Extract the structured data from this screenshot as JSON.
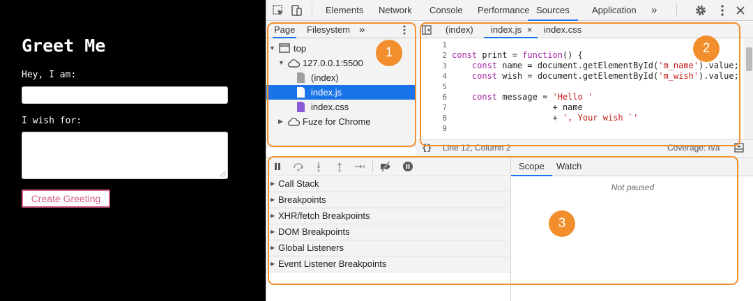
{
  "page": {
    "title": "Greet Me",
    "name_label": "Hey, I am:",
    "wish_label": "I wish for:",
    "button_label": "Create Greeting"
  },
  "devtools": {
    "tabs": [
      "Elements",
      "Network",
      "Console",
      "Performance",
      "Sources",
      "Application"
    ],
    "active_tab": "Sources",
    "more": "»",
    "navigator": {
      "tabs": [
        "Page",
        "Filesystem"
      ],
      "more": "»",
      "tree": [
        {
          "label": "top"
        },
        {
          "label": "127.0.0.1:5500"
        },
        {
          "label": "(index)"
        },
        {
          "label": "index.js",
          "selected": true
        },
        {
          "label": "index.css"
        },
        {
          "label": "Fuze for Chrome"
        }
      ]
    },
    "editor": {
      "tabs": [
        "(index)",
        "index.js",
        "index.css"
      ],
      "active_tab": "index.js",
      "close": "×",
      "lines": [
        {
          "n": "1",
          "code": ""
        },
        {
          "n": "2",
          "code": "const print = function() {"
        },
        {
          "n": "3",
          "code": "    const name = document.getElementById('m_name').value;"
        },
        {
          "n": "4",
          "code": "    const wish = document.getElementById('m_wish').value;"
        },
        {
          "n": "5",
          "code": ""
        },
        {
          "n": "6",
          "code": "    const message = 'Hello '"
        },
        {
          "n": "7",
          "code": "                    + name"
        },
        {
          "n": "8",
          "code": "                    + ', Your wish `'"
        },
        {
          "n": "9",
          "code": ""
        }
      ],
      "status_left": "Line 12, Column 2",
      "status_right": "Coverage: n/a",
      "format_icon": "{}"
    },
    "debugger": {
      "sections": [
        "Call Stack",
        "Breakpoints",
        "XHR/fetch Breakpoints",
        "DOM Breakpoints",
        "Global Listeners",
        "Event Listener Breakpoints"
      ],
      "right_tabs": [
        "Scope",
        "Watch"
      ],
      "active_right_tab": "Scope",
      "not_paused": "Not paused"
    }
  },
  "annotations": [
    {
      "label": "1"
    },
    {
      "label": "2"
    },
    {
      "label": "3"
    }
  ],
  "colors": {
    "accent": "#1a73e8",
    "callout": "#f28e2b",
    "button_border": "#d6608f"
  }
}
